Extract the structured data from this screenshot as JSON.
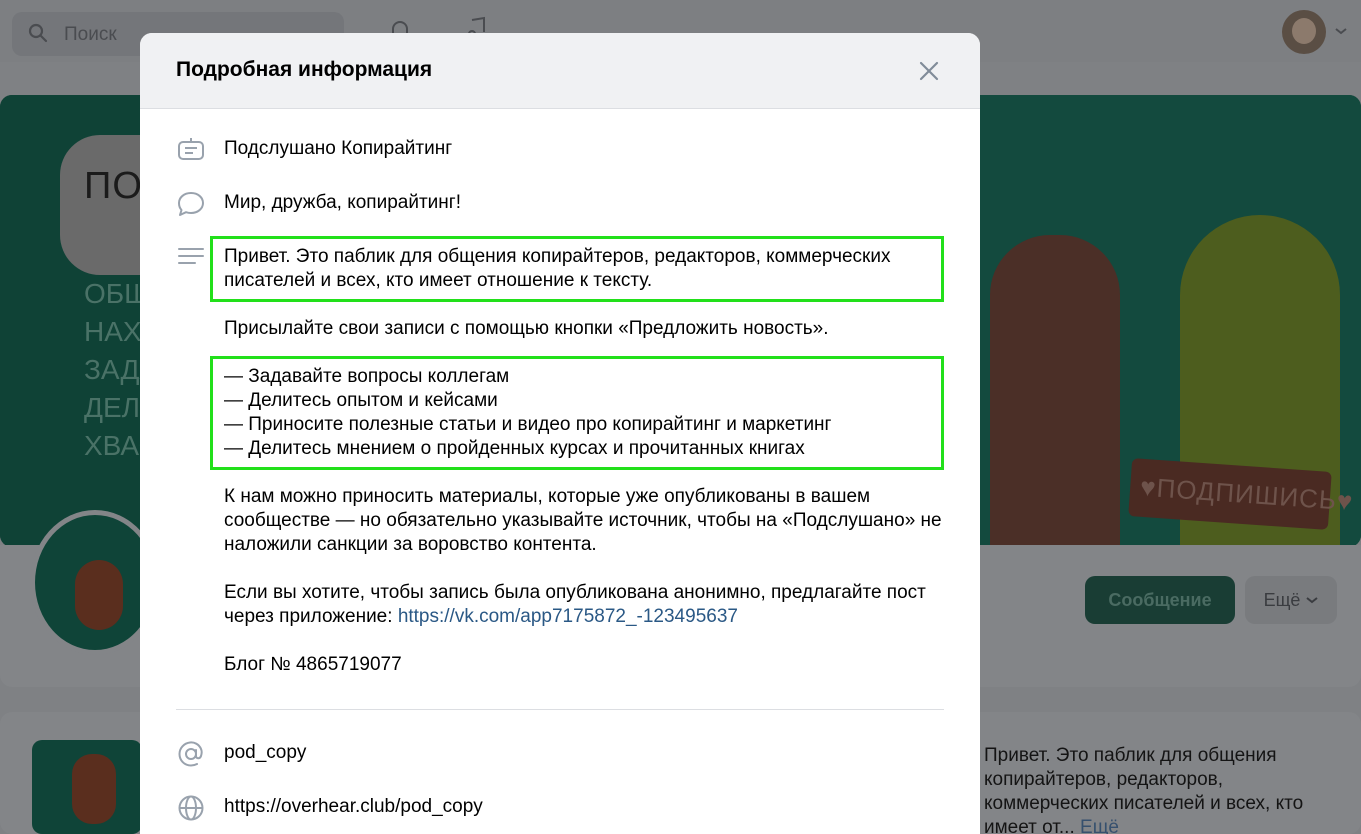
{
  "topbar": {
    "search_placeholder": "Поиск"
  },
  "cover": {
    "bubble_text": "ПОД",
    "left_lines": [
      "ОБЩА",
      "НАХО",
      "ЗАДА",
      "ДЕЛИ",
      "ХВАС"
    ],
    "sign_text": "♥ПОДПИШИСЬ♥"
  },
  "profile": {
    "message_button": "Сообщение",
    "more_button": "Ещё"
  },
  "post": {
    "preview_text": "Привет. Это паблик для общения копирайтеров, редакторов, коммерческих писателей и всех, кто имеет от...",
    "more_link": "Ещё"
  },
  "modal": {
    "title": "Подробная информация",
    "community_name": "Подслушано Копирайтинг",
    "status": "Мир, дружба, копирайтинг!",
    "description": {
      "p1": "Привет. Это паблик для общения копирайтеров, редакторов, коммерческих писателей и всех, кто имеет отношение к тексту.",
      "p2": "Присылайте свои записи с помощью кнопки «Предложить новость».",
      "bullets": [
        "— Задавайте вопросы коллегам",
        "— Делитесь опытом и кейсами",
        "— Приносите полезные статьи и видео про копирайтинг и маркетинг",
        "— Делитесь мнением о пройденных курсах и прочитанных книгах"
      ],
      "p3": "К нам можно приносить материалы, которые уже опубликованы в вашем сообществе — но обязательно указывайте источник, чтобы на «Подслушано» не наложили санкции за воровство контента.",
      "p4_text": "Если вы хотите, чтобы запись была опубликована анонимно, предлагайте пост через приложение: ",
      "p4_link": "https://vk.com/app7175872_-123495637",
      "p5": "Блог № 4865719077"
    },
    "short_name": "pod_copy",
    "website": "https://overhear.club/pod_copy"
  },
  "colors": {
    "highlight": "#22e01a",
    "link": "#2a5885",
    "icon": "#99a2ad"
  }
}
